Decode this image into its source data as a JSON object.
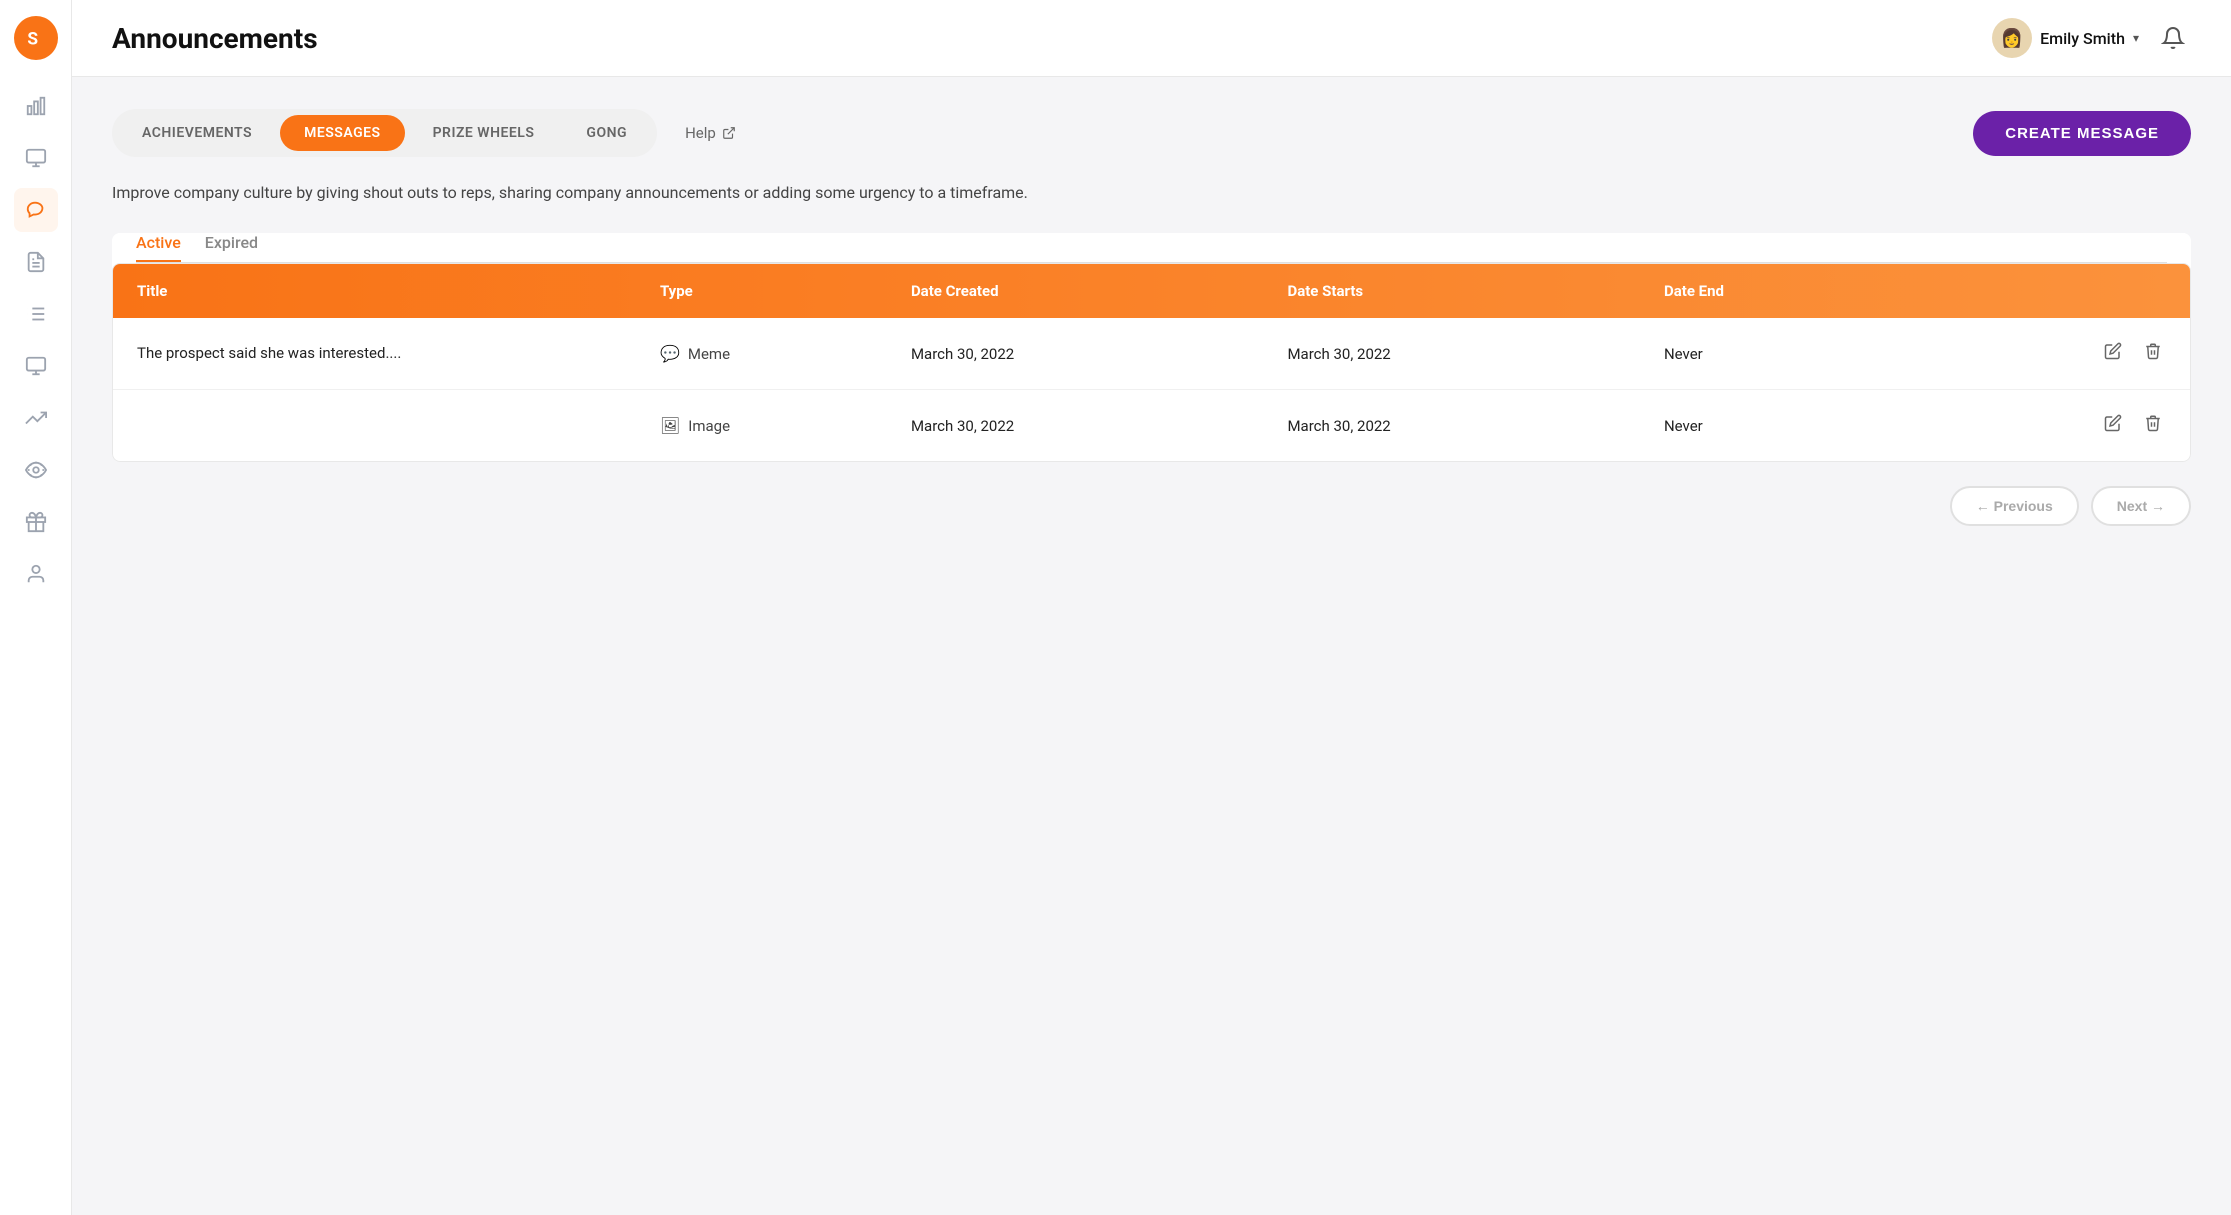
{
  "app": {
    "logo": "S"
  },
  "sidebar": {
    "items": [
      {
        "id": "charts",
        "icon": "bar-chart",
        "active": false
      },
      {
        "id": "dashboard",
        "icon": "monitor",
        "active": false
      },
      {
        "id": "announcements",
        "icon": "megaphone",
        "active": true
      },
      {
        "id": "reports",
        "icon": "file-text",
        "active": false
      },
      {
        "id": "list",
        "icon": "list",
        "active": false
      },
      {
        "id": "desktop",
        "icon": "desktop",
        "active": false
      },
      {
        "id": "trending",
        "icon": "trending-up",
        "active": false
      },
      {
        "id": "eye",
        "icon": "eye-special",
        "active": false
      },
      {
        "id": "gift",
        "icon": "gift",
        "active": false
      },
      {
        "id": "user",
        "icon": "user",
        "active": false
      }
    ]
  },
  "header": {
    "title": "Announcements",
    "user": {
      "name": "Emily Smith",
      "avatar_emoji": "👩"
    },
    "bell": "🔔"
  },
  "tabs": [
    {
      "id": "achievements",
      "label": "ACHIEVEMENTS",
      "active": false
    },
    {
      "id": "messages",
      "label": "MESSAGES",
      "active": true
    },
    {
      "id": "prize-wheels",
      "label": "PRIZE WHEELS",
      "active": false
    },
    {
      "id": "gong",
      "label": "GONG",
      "active": false
    }
  ],
  "help": {
    "label": "Help"
  },
  "create_button": {
    "label": "CREATE MESSAGE"
  },
  "description": "Improve company culture by giving shout outs to reps, sharing company announcements or adding some urgency to a timeframe.",
  "filter_tabs": [
    {
      "id": "active",
      "label": "Active",
      "active": true
    },
    {
      "id": "expired",
      "label": "Expired",
      "active": false
    }
  ],
  "table": {
    "headers": [
      {
        "id": "title",
        "label": "Title"
      },
      {
        "id": "type",
        "label": "Type"
      },
      {
        "id": "date-created",
        "label": "Date Created"
      },
      {
        "id": "date-starts",
        "label": "Date Starts"
      },
      {
        "id": "date-end",
        "label": "Date End"
      },
      {
        "id": "actions",
        "label": ""
      }
    ],
    "rows": [
      {
        "title": "The prospect said she was interested....",
        "type": "Meme",
        "type_icon": "💬",
        "date_created": "March 30, 2022",
        "date_starts": "March 30, 2022",
        "date_end": "Never"
      },
      {
        "title": "",
        "type": "Image",
        "type_icon": "🖼",
        "date_created": "March 30, 2022",
        "date_starts": "March 30, 2022",
        "date_end": "Never"
      }
    ]
  },
  "pagination": {
    "previous_label": "← Previous",
    "next_label": "Next →"
  }
}
